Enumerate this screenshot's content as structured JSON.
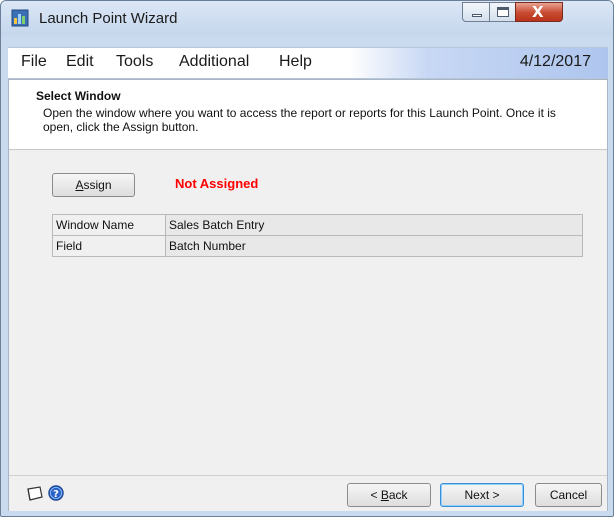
{
  "window": {
    "title": "Launch Point Wizard",
    "close_glyph": "X"
  },
  "icons": {
    "app": "launch-point-app-icon",
    "minimize": "minimize-icon",
    "maximize": "maximize-icon",
    "close": "close-icon",
    "chevron": "double-chevron-icon",
    "note": "note-icon",
    "help": "help-icon"
  },
  "menubar": {
    "items": [
      "File",
      "Edit",
      "Tools",
      "Additional",
      "Help"
    ],
    "date": "4/12/2017",
    "chevron": "»"
  },
  "header": {
    "title": "Select Window",
    "description": "Open the window where you want to access the report or reports for this Launch Point.  Once it is open, click the Assign button."
  },
  "assign": {
    "button_prefix": "",
    "button_mnemonic": "A",
    "button_rest": "ssign",
    "status": "Not Assigned",
    "status_color": "#ff0000"
  },
  "details": {
    "rows": [
      {
        "label": "Window Name",
        "value": "Sales Batch Entry"
      },
      {
        "label": "Field",
        "value": "Batch Number"
      }
    ]
  },
  "footer": {
    "back_prefix": "< ",
    "back_mnemonic": "B",
    "back_rest": "ack",
    "next_label": "Next >",
    "cancel_label": "Cancel"
  },
  "colors": {
    "title_bar": "#c5d6ec",
    "accent_blue": "#aec5ee",
    "close_red": "#c84a2f"
  }
}
